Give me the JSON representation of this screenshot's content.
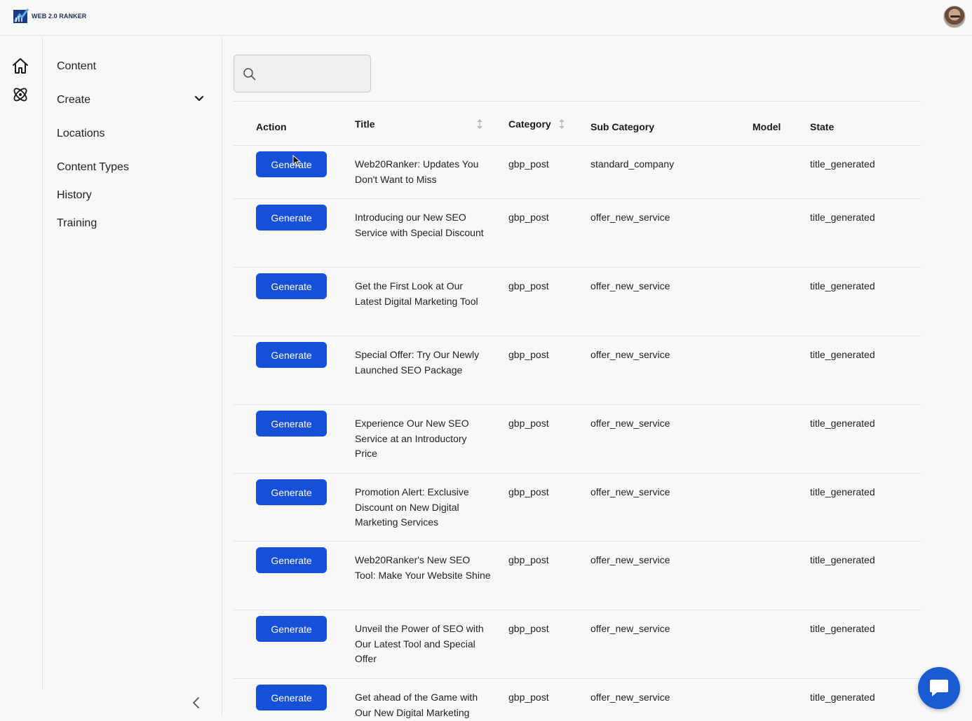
{
  "app": {
    "logo_text": "WEB 2.0 RANKER",
    "accent_color": "#1650d8"
  },
  "rail": {
    "icons": [
      "home-icon",
      "atom-icon"
    ]
  },
  "sidebar": {
    "items": [
      {
        "label": "Content"
      },
      {
        "label": "Create"
      },
      {
        "label": "Locations"
      },
      {
        "label": "Content Types"
      },
      {
        "label": "History"
      },
      {
        "label": "Training"
      }
    ]
  },
  "search": {
    "value": "",
    "placeholder": ""
  },
  "table": {
    "headers": {
      "action": "Action",
      "title": "Title",
      "category": "Category",
      "sub_category": "Sub Category",
      "model": "Model",
      "state": "State"
    },
    "rows": [
      {
        "action": "Generate",
        "title": "Web20Ranker: Updates You Don't Want to Miss",
        "category": "gbp_post",
        "sub_category": "standard_company",
        "model": "",
        "state": "title_generated"
      },
      {
        "action": "Generate",
        "title": "Introducing our New SEO Service with Special Discount",
        "category": "gbp_post",
        "sub_category": "offer_new_service",
        "model": "",
        "state": "title_generated"
      },
      {
        "action": "Generate",
        "title": "Get the First Look at Our Latest Digital Marketing Tool",
        "category": "gbp_post",
        "sub_category": "offer_new_service",
        "model": "",
        "state": "title_generated"
      },
      {
        "action": "Generate",
        "title": "Special Offer: Try Our Newly Launched SEO Package",
        "category": "gbp_post",
        "sub_category": "offer_new_service",
        "model": "",
        "state": "title_generated"
      },
      {
        "action": "Generate",
        "title": "Experience Our New SEO Service at an Introductory Price",
        "category": "gbp_post",
        "sub_category": "offer_new_service",
        "model": "",
        "state": "title_generated"
      },
      {
        "action": "Generate",
        "title": "Promotion Alert: Exclusive Discount on New Digital Marketing Services",
        "category": "gbp_post",
        "sub_category": "offer_new_service",
        "model": "",
        "state": "title_generated"
      },
      {
        "action": "Generate",
        "title": "Web20Ranker's New SEO Tool: Make Your Website Shine",
        "category": "gbp_post",
        "sub_category": "offer_new_service",
        "model": "",
        "state": "title_generated"
      },
      {
        "action": "Generate",
        "title": "Unveil the Power of SEO with Our Latest Tool and Special Offer",
        "category": "gbp_post",
        "sub_category": "offer_new_service",
        "model": "",
        "state": "title_generated"
      },
      {
        "action": "Generate",
        "title": "Get ahead of the Game with Our New Digital Marketing",
        "category": "gbp_post",
        "sub_category": "offer_new_service",
        "model": "",
        "state": "title_generated"
      }
    ]
  }
}
